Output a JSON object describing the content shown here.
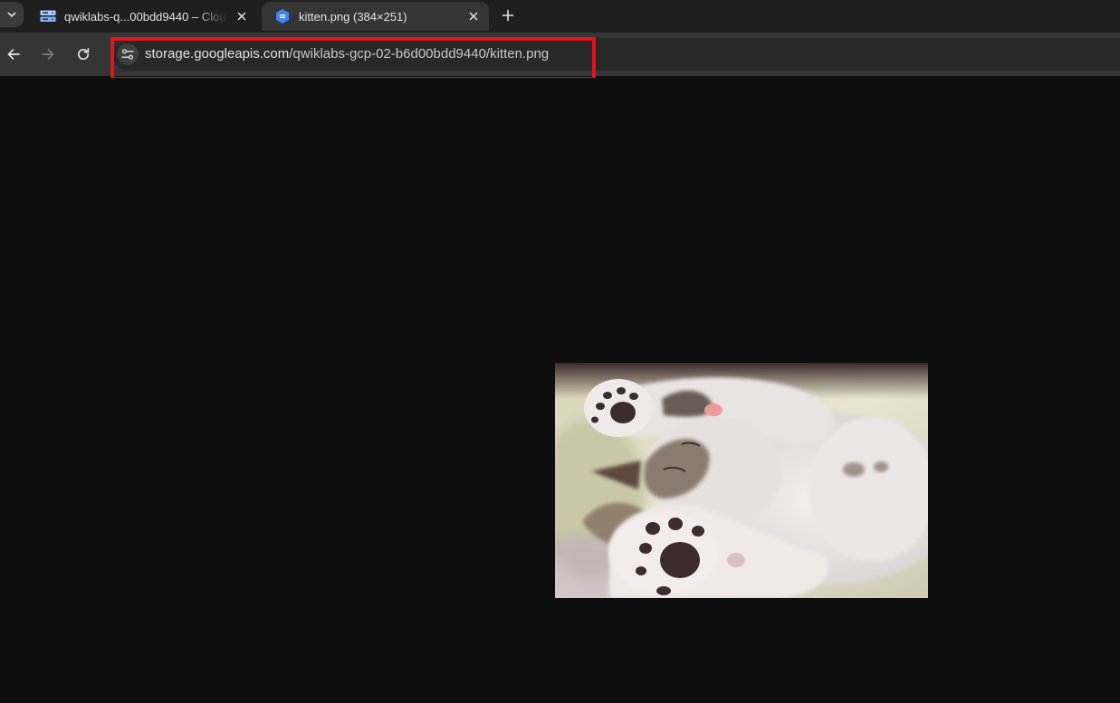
{
  "tabs": [
    {
      "title": "qwiklabs-q...00bdd9440 – Clou",
      "active": false,
      "favicon": "cloud-storage-icon"
    },
    {
      "title": "kitten.png (384×251)",
      "active": true,
      "favicon": "gcp-hexagon-icon"
    }
  ],
  "toolbar": {
    "url_host": "storage.googleapis.com",
    "url_path": "/qwiklabs-gcp-02-b6d00bdd9440/kitten.png"
  },
  "colors": {
    "highlight": "#e3141b",
    "page_background": "#0e0e0e",
    "gcp_blue": "#4285f4"
  },
  "content": {
    "image_description_icon": "kitten-photo"
  }
}
